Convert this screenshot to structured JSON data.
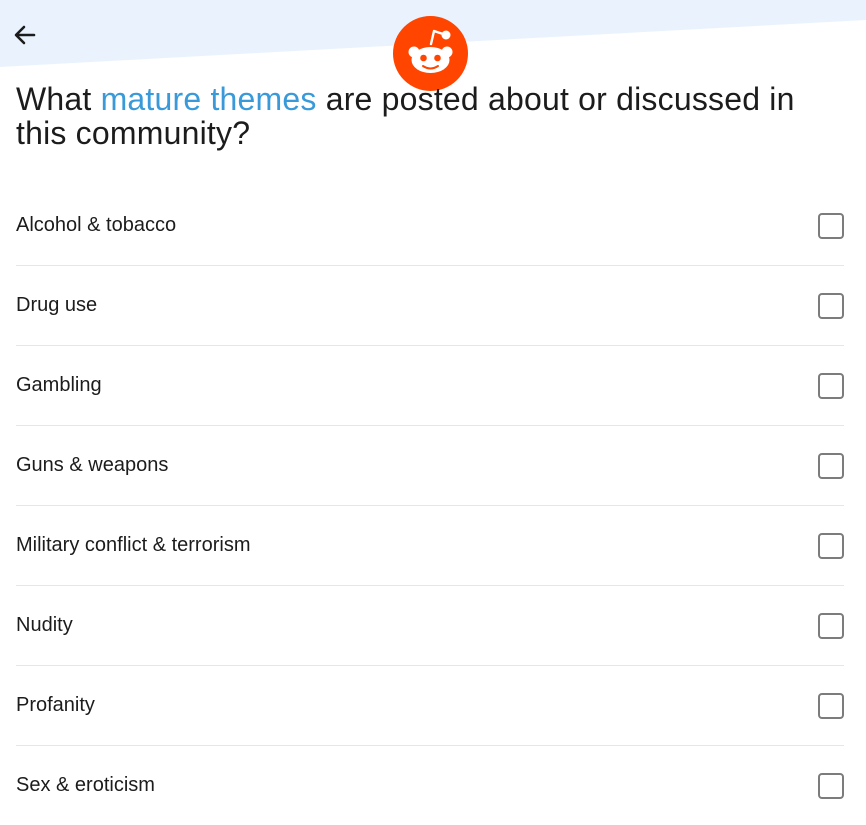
{
  "header": {
    "back_icon": "arrow-left-icon",
    "logo_icon": "reddit-logo-icon",
    "band_color": "#eaf3fd",
    "logo_color": "#ff4500"
  },
  "question": {
    "prefix": "What ",
    "highlight": "mature themes",
    "suffix": " are posted about or discussed in this community?",
    "highlight_color": "#3a9ad9"
  },
  "options": [
    {
      "label": "Alcohol & tobacco",
      "checked": false
    },
    {
      "label": "Drug use",
      "checked": false
    },
    {
      "label": "Gambling",
      "checked": false
    },
    {
      "label": "Guns & weapons",
      "checked": false
    },
    {
      "label": "Military conflict & terrorism",
      "checked": false
    },
    {
      "label": "Nudity",
      "checked": false
    },
    {
      "label": "Profanity",
      "checked": false
    },
    {
      "label": "Sex & eroticism",
      "checked": false
    }
  ]
}
